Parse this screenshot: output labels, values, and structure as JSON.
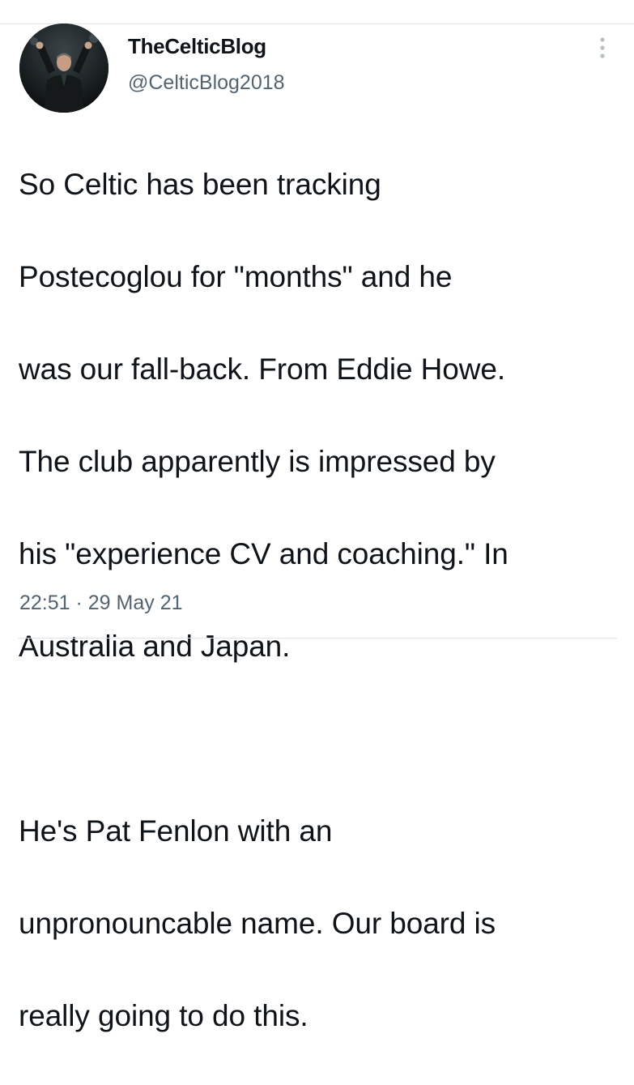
{
  "tweet": {
    "display_name": "TheCelticBlog",
    "handle": "@CelticBlog2018",
    "lines": [
      "So Celtic has been tracking",
      "Postecoglou for \"months\" and he",
      "was our fall-back. From Eddie Howe.",
      "The club apparently is impressed by",
      "his \"experience CV and coaching.\" In",
      "Australia and Japan.",
      "",
      "He's Pat Fenlon with an",
      "unpronouncable name. Our board is",
      "really going to do this."
    ],
    "timestamp": "22:51 · 29 May 21"
  },
  "icons": {
    "more": "more-vertical-icon",
    "avatar": "profile-photo"
  },
  "colors": {
    "text_primary": "#0f1419",
    "text_secondary": "#536471",
    "divider": "#e1e5e8",
    "avatar_bg": "#101416"
  }
}
